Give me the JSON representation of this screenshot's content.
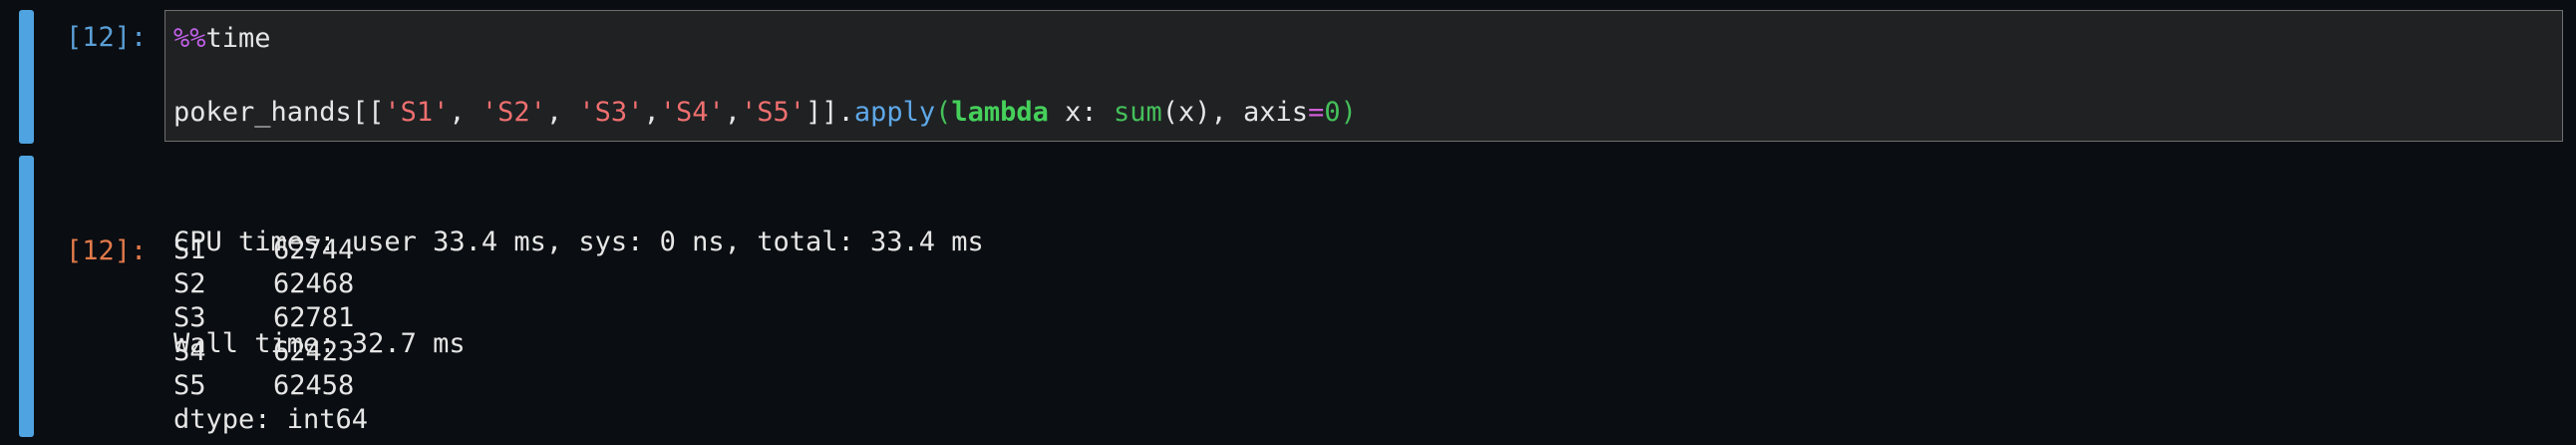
{
  "input_cell": {
    "prompt": "[12]:",
    "line1": {
      "magic": "%%",
      "rest": "time"
    },
    "line2": {
      "obj": "poker_hands",
      "open": "[[",
      "s1": "'S1'",
      "sep1": ", ",
      "s2": "'S2'",
      "sep2": ", ",
      "s3": "'S3'",
      "sep3": ",",
      "s4": "'S4'",
      "sep4": ",",
      "s5": "'S5'",
      "close": "]].",
      "method": "apply",
      "paren_open": "(",
      "kw": "lambda",
      "arg": " x: ",
      "builtin": "sum",
      "call": "(x), axis",
      "eq": "=",
      "zero": "0",
      "paren_close": ")"
    }
  },
  "output_cell": {
    "stream_lines": [
      "CPU times: user 33.4 ms, sys: 0 ns, total: 33.4 ms",
      "Wall time: 32.7 ms"
    ],
    "prompt": "[12]:",
    "series": [
      {
        "label": "S1",
        "value": "62744"
      },
      {
        "label": "S2",
        "value": "62468"
      },
      {
        "label": "S3",
        "value": "62781"
      },
      {
        "label": "S4",
        "value": "62423"
      },
      {
        "label": "S5",
        "value": "62458"
      }
    ],
    "dtype": "dtype: int64"
  },
  "colors": {
    "background": "#0a0d11",
    "cell_bar": "#4fa3e0",
    "editor_bg": "#1f2123",
    "in_prompt": "#5a9fd6",
    "out_prompt": "#e27a4b",
    "string": "#ef6f6f",
    "keyword": "#45d05a",
    "magic": "#c060e6"
  }
}
